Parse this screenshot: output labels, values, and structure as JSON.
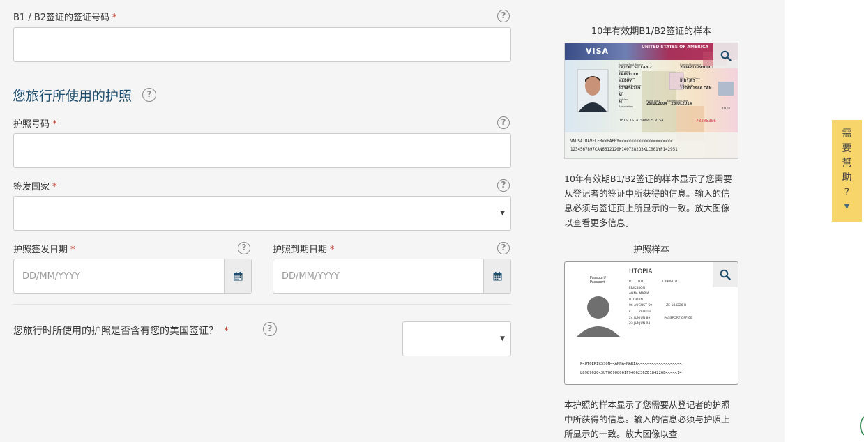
{
  "visa_number": {
    "label": "B1 / B2签证的签证号码",
    "required_mark": "*",
    "value": ""
  },
  "passport_section": {
    "title": "您旅行所使用的护照",
    "passport_number": {
      "label": "护照号码",
      "required_mark": "*",
      "value": ""
    },
    "issuing_country": {
      "label": "签发国家",
      "required_mark": "*",
      "value": ""
    },
    "issue_date": {
      "label": "护照签发日期",
      "required_mark": "*",
      "placeholder": "DD/MM/YYYY"
    },
    "expiry_date": {
      "label": "护照到期日期",
      "required_mark": "*",
      "placeholder": "DD/MM/YYYY"
    }
  },
  "contains_visa": {
    "question": "您旅行时所使用的护照是否含有您的美国签证？",
    "required_mark": "*",
    "value": ""
  },
  "help_glyph": "?",
  "sidebar": {
    "visa_sample": {
      "caption": "10年有效期B1/B2签证的样本",
      "description": "10年有效期B1/B2签证的样本显示了您需要从登记者的签证中所获得的信息。输入的信息必须与签证页上所显示的一致。放大图像以查看更多信息。",
      "card": {
        "header": "VISA",
        "banner": "UNITED STATES OF AMERICA",
        "issuing_post_label": "Issuing Post Name",
        "issuing_post": "CA/EX/CSD LAB 2",
        "control_number_label": "Control Number",
        "control_number": "20042112930001",
        "surname_label": "Surname",
        "surname": "TRAVELER",
        "given_name_label": "Given Name",
        "given_name": "HAPPY",
        "passport_number_label": "Passport Number",
        "passport_number": "123456789",
        "sex_label": "Sex",
        "sex": "M",
        "birth_date_label": "Birth Date",
        "birth_date": "12DEC1966",
        "nationality": "CAN",
        "visa_type_label": "Visa Type/Class",
        "visa_type": "R B1/B2",
        "entries_label": "Entries",
        "entries": "M",
        "issue_date_label": "Issue Date",
        "issue_date": "29JUL2004",
        "expiration_label": "Expiration Date",
        "expiration_date": "28JUL2014",
        "annotation_label": "Annotation",
        "sample_note": "THIS IS A SAMPLE VISA",
        "foil_number": "73205386",
        "side_number": "0101",
        "mrz_line1": "VNUSATRAVELER<<HAPPY<<<<<<<<<<<<<<<<<<<<<<",
        "mrz_line2": "1234567897CAN6612120M1407282O3XLC001YP142951"
      }
    },
    "passport_sample": {
      "caption": "护照样本",
      "description": "本护照的样本显示了您需要从登记者的护照中所获得的信息。输入的信息必须与护照上所显示的一致。放大图像以查",
      "card": {
        "country": "UTOPIA",
        "passport_word": "Passport/",
        "passport_word2": "Passport",
        "type": "P",
        "code": "UTO",
        "number": "L898902C",
        "surname": "ERIKSSON",
        "given_names": "ANNA MARIA",
        "nationality": "UTOPIAN",
        "birth_date": "06 AUGUST 69",
        "personal_no": "ZE 184226 B",
        "sex": "F",
        "place_of_birth": "ZENITH",
        "issue_date": "24 JUNJUN 89",
        "authority": "PASSPORT OFFICE",
        "expiry_date": "23 JUNJUN 94",
        "mrz_line1": "P<UTOERIKSSON<<ANNA<MARIA<<<<<<<<<<<<<<<<<<<",
        "mrz_line2": "L898902C<3UTO6908061F9406236ZE184226B<<<<<14"
      }
    }
  },
  "help_tab": {
    "chars": [
      "需",
      "要",
      "幫",
      "助",
      "?"
    ],
    "arrow": "▼"
  },
  "colors": {
    "accent_text": "#1f4e6d",
    "required": "#c0392b",
    "help_tab_bg": "#f7d56a",
    "page_bg": "#f5f5f5"
  }
}
